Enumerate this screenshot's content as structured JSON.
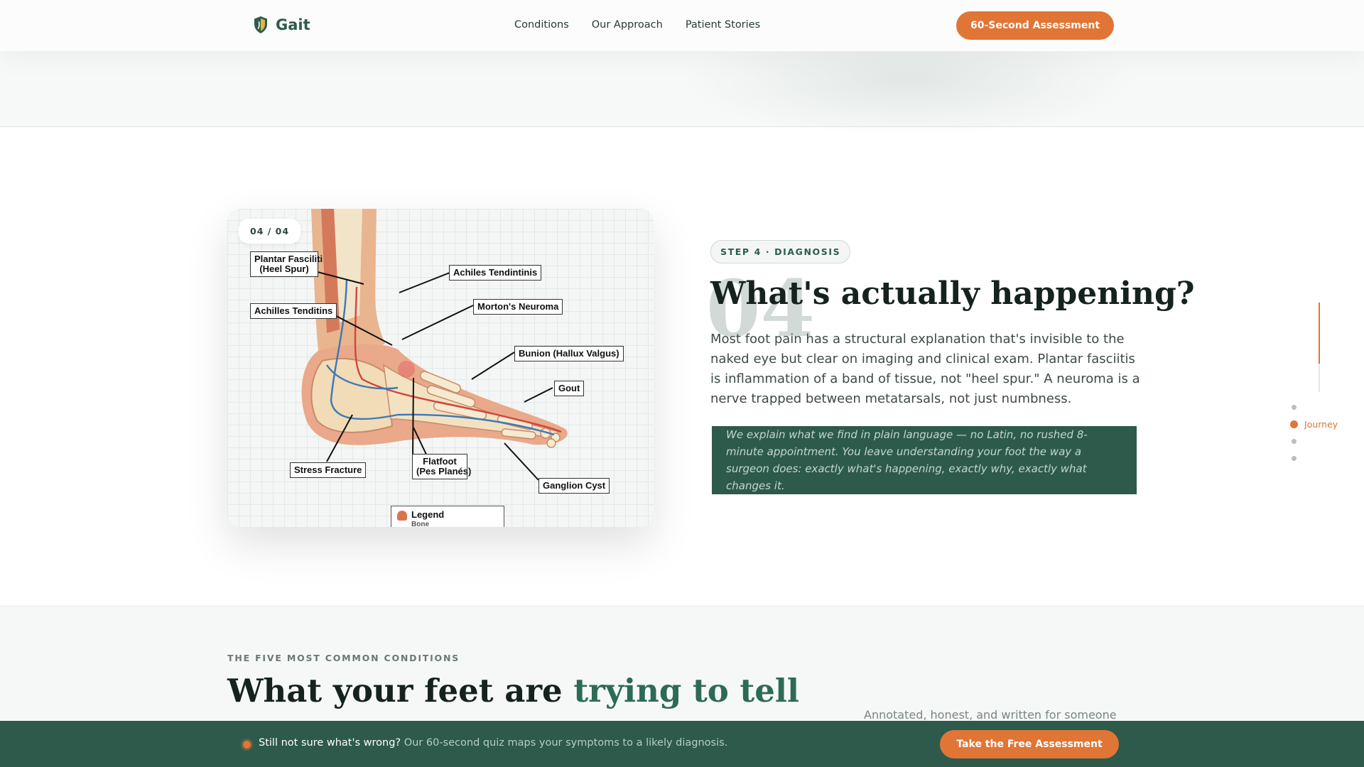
{
  "header": {
    "brand": "Gait",
    "nav": [
      "Conditions",
      "Our Approach",
      "Patient Stories"
    ],
    "cta": "60-Second Assessment"
  },
  "figure": {
    "counter": "04 / 04",
    "callouts": {
      "plantar": [
        "Plantar Fasciliti",
        "(Heel Spur)"
      ],
      "achilles_top": "Achiles Tendintinis",
      "achilles_left": "Achilles Tenditins",
      "morton": "Morton's Neuroma",
      "bunion": "Bunion (Hallux Valgus)",
      "gout": "Gout",
      "stress": "Stress Fracture",
      "flatfoot": [
        "Flatfoot",
        "(Pes Planés)"
      ],
      "ganglion": "Ganglion Cyst"
    },
    "legend_title": "Legend",
    "legend_item": "Bone"
  },
  "step": {
    "badge": "STEP 4 · DIAGNOSIS",
    "number": "04",
    "title": "What's actually happening?",
    "body": "Most foot pain has a structural explanation that's invisible to the naked eye but clear on imaging and clinical exam. Plantar fasciitis is inflammation of a band of tissue, not \"heel spur.\" A neuroma is a nerve trapped between metatarsals, not just numbness.",
    "quote": "We explain what we find in plain language — no Latin, no rushed 8-minute appointment. You leave understanding your foot the way a surgeon does: exactly what's happening, exactly why, exactly what changes it."
  },
  "rail": {
    "active_label": "Journey",
    "progress": 0.68
  },
  "conditions": {
    "eyebrow": "THE FIVE MOST COMMON CONDITIONS",
    "title_start": "What your feet are ",
    "title_accent": "trying to tell",
    "subtitle": "Annotated, honest, and written for someone"
  },
  "sticky": {
    "lead": "Still not sure what's wrong?",
    "text": " Our 60-second quiz maps your symptoms to a likely diagnosis.",
    "cta": "Take the Free Assessment"
  },
  "colors": {
    "brand_green": "#2d5a4b",
    "accent_orange": "#e07536"
  }
}
